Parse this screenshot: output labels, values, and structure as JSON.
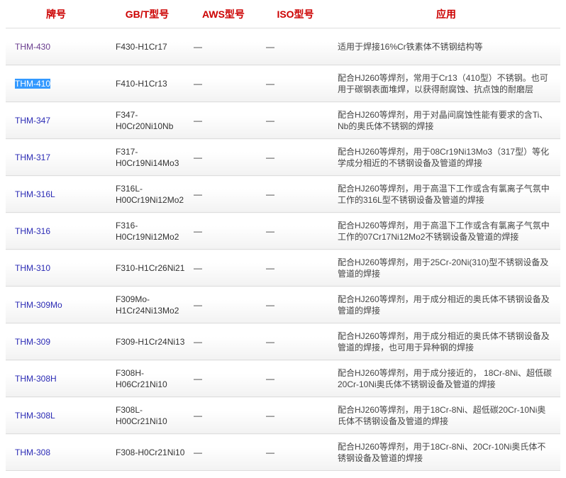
{
  "colors": {
    "header_text": "#cc0000",
    "link": "#2b2bb5",
    "visited_link": "#6a3d8f",
    "selection_bg": "#3399ff",
    "selection_text": "#ffffff",
    "body_text": "#333333"
  },
  "table": {
    "headers": [
      "牌号",
      "GB/T型号",
      "AWS型号",
      "ISO型号",
      "应用"
    ],
    "rows": [
      {
        "grade": "THM-430",
        "gbt_model": "F430-H1Cr17",
        "aws_model": "—",
        "iso_model": "—",
        "application": "适用于焊接16%Cr铁素体不锈钢结构等",
        "visited": true
      },
      {
        "grade": "THM-410",
        "gbt_model": "F410-H1Cr13",
        "aws_model": "—",
        "iso_model": "—",
        "application": "配合HJ260等焊剂，常用于Cr13（410型）不锈钢。也可用于碳钢表面堆焊，以获得耐腐蚀、抗点蚀的耐磨层",
        "selected": true
      },
      {
        "grade": "THM-347",
        "gbt_model": "F347-H0Cr20Ni10Nb",
        "aws_model": "—",
        "iso_model": "—",
        "application": "配合HJ260等焊剂，用于对晶间腐蚀性能有要求的含Ti、Nb的奥氏体不锈钢的焊接"
      },
      {
        "grade": "THM-317",
        "gbt_model": "F317-H0Cr19Ni14Mo3",
        "aws_model": "—",
        "iso_model": "—",
        "application": "配合HJ260等焊剂，用于08Cr19Ni13Mo3（317型）等化学成分相近的不锈钢设备及管道的焊接"
      },
      {
        "grade": "THM-316L",
        "gbt_model": "F316L-H00Cr19Ni12Mo2",
        "aws_model": "—",
        "iso_model": "—",
        "application": "配合HJ260等焊剂，用于高温下工作或含有氯离子气氛中工作的316L型不锈钢设备及管道的焊接"
      },
      {
        "grade": "THM-316",
        "gbt_model": "F316-H0Cr19Ni12Mo2",
        "aws_model": "—",
        "iso_model": "—",
        "application": "配合HJ260等焊剂，用于高温下工作或含有氯离子气氛中工作的07Cr17Ni12Mo2不锈钢设备及管道的焊接"
      },
      {
        "grade": "THM-310",
        "gbt_model": "F310-H1Cr26Ni21",
        "aws_model": "—",
        "iso_model": "—",
        "application": "配合HJ260等焊剂，用于25Cr-20Ni(310)型不锈钢设备及管道的焊接"
      },
      {
        "grade": "THM-309Mo",
        "gbt_model": "F309Mo-H1Cr24Ni13Mo2",
        "aws_model": "—",
        "iso_model": "—",
        "application": "配合HJ260等焊剂，用于成分相近的奥氏体不锈钢设备及管道的焊接"
      },
      {
        "grade": "THM-309",
        "gbt_model": "F309-H1Cr24Ni13",
        "aws_model": "—",
        "iso_model": "—",
        "application": "配合HJ260等焊剂，用于成分相近的奥氏体不锈钢设备及管道的焊接，也可用于异种钢的焊接"
      },
      {
        "grade": "THM-308H",
        "gbt_model": "F308H-H06Cr21Ni10",
        "aws_model": "—",
        "iso_model": "—",
        "application": "配合HJ260等焊剂，用于成分接近的， 18Cr-8Ni、超低碳20Cr-10Ni奥氏体不锈钢设备及管道的焊接"
      },
      {
        "grade": "THM-308L",
        "gbt_model": "F308L-H00Cr21Ni10",
        "aws_model": "—",
        "iso_model": "—",
        "application": "配合HJ260等焊剂，用于18Cr-8Ni、超低碳20Cr-10Ni奥氏体不锈钢设备及管道的焊接"
      },
      {
        "grade": "THM-308",
        "gbt_model": "F308-H0Cr21Ni10",
        "aws_model": "—",
        "iso_model": "—",
        "application": "配合HJ260等焊剂，用于18Cr-8Ni、20Cr-10Ni奥氏体不锈钢设备及管道的焊接"
      }
    ]
  }
}
